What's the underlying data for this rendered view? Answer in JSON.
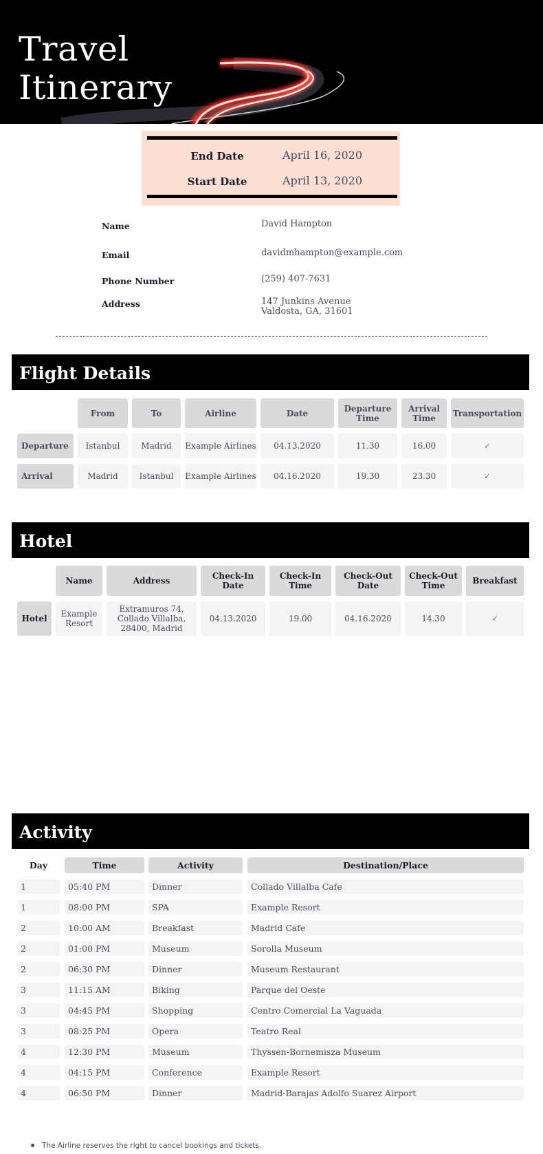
{
  "banner": {
    "title_line1": "Travel",
    "title_line2": "Itinerary"
  },
  "dates": {
    "end_label": "End Date",
    "end_value": "April 16, 2020",
    "start_label": "Start Date",
    "start_value": "April 13, 2020",
    "box_color": "#fde0d4"
  },
  "contact": {
    "name_label": "Name",
    "name_value": "David Hampton",
    "email_label": "Email",
    "email_value": "davidmhampton@example.com",
    "phone_label": "Phone Number",
    "phone_value": "(259) 407-7631",
    "address_label": "Address",
    "address_line1": "147 Junkins Avenue",
    "address_line2": "Valdosta, GA, 31601"
  },
  "flight": {
    "title": "Flight Details",
    "headers": [
      "From",
      "To",
      "Airline",
      "Date",
      "Departure Time",
      "Arrival Time",
      "Transportation"
    ],
    "rows": [
      {
        "label": "Departure",
        "from": "Istanbul",
        "to": "Madrid",
        "airline": "Example Airlines",
        "date": "04.13.2020",
        "departure_time": "11.30",
        "arrival_time": "16.00",
        "transportation": "✓"
      },
      {
        "label": "Arrival",
        "from": "Madrid",
        "to": "Istanbul",
        "airline": "Example Airlines",
        "date": "04.16.2020",
        "departure_time": "19.30",
        "arrival_time": "23.30",
        "transportation": "✓"
      }
    ]
  },
  "hotel": {
    "title": "Hotel",
    "headers": [
      "Name",
      "Address",
      "Check-In Date",
      "Check-In Time",
      "Check-Out Date",
      "Check-Out Time",
      "Breakfast"
    ],
    "row": {
      "label": "Hotel",
      "name": "Example Resort",
      "address": "Extramuros 74, Collado Villalba, 28400, Madrid",
      "checkin_date": "04.13.2020",
      "checkin_time": "19.00",
      "checkout_date": "04.16.2020",
      "checkout_time": "14.30",
      "breakfast": "✓"
    }
  },
  "activity": {
    "title": "Activity",
    "headers": [
      "Day",
      "Time",
      "Activity",
      "Destination/Place"
    ],
    "rows": [
      {
        "day": "1",
        "time": "05:40 PM",
        "activity": "Dinner",
        "place": "Collado Villalba Cafe"
      },
      {
        "day": "1",
        "time": "08:00 PM",
        "activity": "SPA",
        "place": "Example Resort"
      },
      {
        "day": "2",
        "time": "10:00 AM",
        "activity": "Breakfast",
        "place": "Madrid Cafe"
      },
      {
        "day": "2",
        "time": "01:00 PM",
        "activity": "Museum",
        "place": "Sorolla Museum"
      },
      {
        "day": "2",
        "time": "06:30 PM",
        "activity": "Dinner",
        "place": "Museum Restaurant"
      },
      {
        "day": "3",
        "time": "11:15 AM",
        "activity": "Biking",
        "place": "Parque del Oeste"
      },
      {
        "day": "3",
        "time": "04:45 PM",
        "activity": "Shopping",
        "place": "Centro Comercial La Vaguada"
      },
      {
        "day": "3",
        "time": "08:25 PM",
        "activity": "Opera",
        "place": "Teatro Real"
      },
      {
        "day": "4",
        "time": "12:30 PM",
        "activity": "Museum",
        "place": "Thyssen-Bornemisza Museum"
      },
      {
        "day": "4",
        "time": "04:15 PM",
        "activity": "Conference",
        "place": "Example Resort"
      },
      {
        "day": "4",
        "time": "06:50 PM",
        "activity": "Dinner",
        "place": "Madrid-Barajas Adolfo Suarez Airport"
      }
    ]
  },
  "notes": [
    "The Airline reserves the right to cancel bookings and tickets."
  ]
}
